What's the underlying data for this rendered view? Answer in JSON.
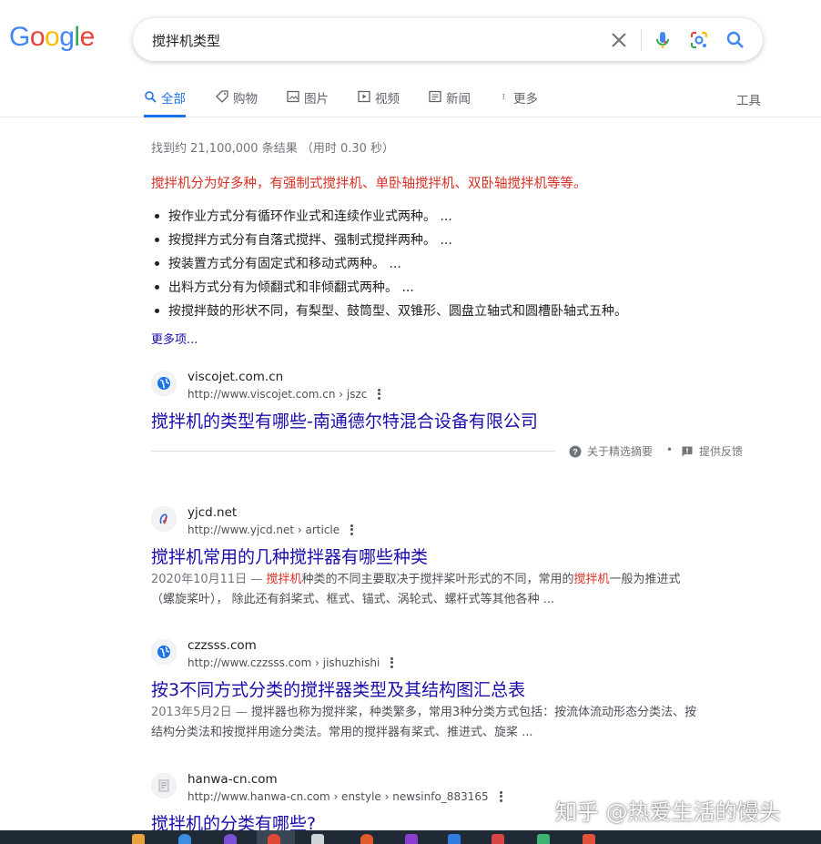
{
  "logo": {
    "letters": [
      "G",
      "o",
      "o",
      "g",
      "l",
      "e"
    ],
    "colors": [
      "#4285f4",
      "#ea4335",
      "#fbbc05",
      "#4285f4",
      "#34a853",
      "#ea4335"
    ]
  },
  "search": {
    "query": "搅拌机类型"
  },
  "tabs": [
    {
      "label": "全部",
      "icon": "search-icon",
      "active": true
    },
    {
      "label": "购物",
      "icon": "tag-icon"
    },
    {
      "label": "图片",
      "icon": "image-icon"
    },
    {
      "label": "视频",
      "icon": "play-icon"
    },
    {
      "label": "新闻",
      "icon": "news-icon"
    },
    {
      "label": "更多",
      "icon": "more-vert-icon"
    }
  ],
  "tools_label": "工具",
  "stats": "找到约 21,100,000 条结果 （用时 0.30 秒）",
  "featured": {
    "headline": "搅拌机分为好多种，有强制式搅拌机、单卧轴搅拌机、双卧轴搅拌机等等。",
    "bullets": [
      "按作业方式分有循环作业式和连续作业式两种。 ...",
      "按搅拌方式分有自落式搅拌、强制式搅拌两种。 ...",
      "按装置方式分有固定式和移动式两种。 ...",
      "出料方式分有为倾翻式和非倾翻式两种。 ...",
      "按搅拌鼓的形状不同，有梨型、鼓筒型、双锥形、圆盘立轴式和圆槽卧轴式五种。"
    ],
    "more": "更多项..."
  },
  "feedback": {
    "about": "关于精选摘要",
    "separator": "•",
    "report": "提供反馈"
  },
  "results": [
    {
      "site": "viscojet.com.cn",
      "url": "http://www.viscojet.com.cn › jszc",
      "title": "搅拌机的类型有哪些-南通德尔特混合设备有限公司"
    },
    {
      "site": "yjcd.net",
      "url": "http://www.yjcd.net › article",
      "title": "搅拌机常用的几种搅拌器有哪些种类",
      "date": "2020年10月11日 —",
      "d1": " ",
      "h1": "搅拌机",
      "d2": "种类的不同主要取决于搅拌桨叶形式的不同，常用的",
      "h2": "搅拌机",
      "d3": "一般为推进式（螺旋桨叶），  除此还有斜桨式、框式、锚式、涡轮式、螺杆式等其他各种 ..."
    },
    {
      "site": "czzsss.com",
      "url": "http://www.czzsss.com › jishuzhishi",
      "title": "按3不同方式分类的搅拌器类型及其结构图汇总表",
      "date": "2013年5月2日 —",
      "d1": " 搅拌器也称为搅拌桨，种类繁多，常用3种分类方式包括：按流体流动形态分类法、按结构分类法和按搅拌用途分类法。常用的搅拌器有桨式、推进式、旋桨 ..."
    },
    {
      "site": "hanwa-cn.com",
      "url": "http://www.hanwa-cn.com › enstyle › newsinfo_883165",
      "title": "搅拌机的分类有哪些?"
    }
  ],
  "watermark": "知乎 @热爱生活的馒头"
}
